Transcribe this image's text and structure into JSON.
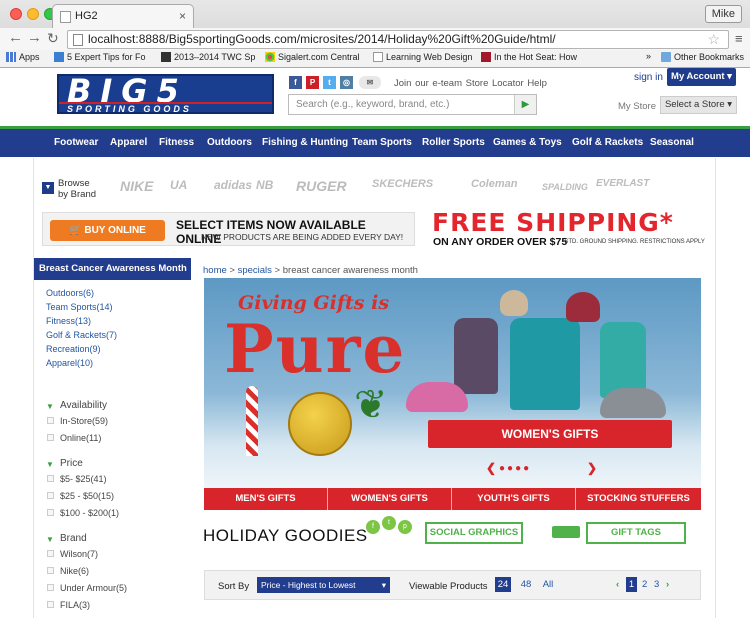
{
  "browser": {
    "tab_title": "HG2",
    "tab_close": "×",
    "user": "Mike",
    "url": "localhost:8888/Big5sportingGoods.com/microsites/2014/Holiday%20Gift%20Guide/html/",
    "bookmarks": [
      "Apps",
      "5 Expert Tips for Fo",
      "2013–2014 TWC Sp",
      "Sigalert.com Central",
      "Learning Web Design",
      "In the Hot Seat: How"
    ],
    "other_bookmarks": "Other Bookmarks",
    "overflow": "»"
  },
  "header": {
    "logo_big": "BIG5",
    "logo_small": "SPORTING GOODS",
    "social": [
      "f",
      "P",
      "t",
      "◎",
      "✉"
    ],
    "links": "Join our e-team   Store Locator   Help",
    "search_placeholder": "Search (e.g., keyword, brand, etc.)",
    "search_btn": "▶",
    "signin": "sign in",
    "account": "My Account ▾",
    "mystore": "My Store",
    "select_store": "Select a Store ▾"
  },
  "nav": [
    "Footwear",
    "Apparel",
    "Fitness",
    "Outdoors",
    "Fishing & Hunting",
    "Team Sports",
    "Roller Sports",
    "Games & Toys",
    "Golf & Rackets",
    "Seasonal"
  ],
  "brands": {
    "browse_line1": "Browse",
    "browse_line2": "by Brand",
    "browse_icon": "▼",
    "list": [
      "NIKE",
      "UA",
      "adidas",
      "NB",
      "RUGER",
      "SKECHERS",
      "Coleman",
      "SPALDING",
      "EVERLAST"
    ]
  },
  "promo": {
    "buy_online": "BUY ONLINE",
    "line1": "SELECT ITEMS NOW AVAILABLE ONLINE",
    "line2": "NEW PRODUCTS ARE BEING ADDED EVERY DAY!",
    "free_shipping": "FREE SHIPPING*",
    "fs_sub": "ON ANY ORDER OVER $75",
    "fs_note": "*STD. GROUND SHIPPING. RESTRICTIONS APPLY"
  },
  "sidebar": {
    "heading": "Breast Cancer Awareness Month",
    "categories": [
      "Outdoors(6)",
      "Team Sports(14)",
      "Fitness(13)",
      "Golf & Rackets(7)",
      "Recreation(9)",
      "Apparel(10)"
    ],
    "facets": [
      {
        "title": "Availability",
        "options": [
          "In-Store(59)",
          "Online(11)"
        ]
      },
      {
        "title": "Price",
        "options": [
          "$5- $25(41)",
          "$25 - $50(15)",
          "$100 - $200(1)"
        ]
      },
      {
        "title": "Brand",
        "options": [
          "Wilson(7)",
          "Nike(6)",
          "Under Armour(5)",
          "FILA(3)"
        ]
      }
    ]
  },
  "breadcrumb": {
    "home": "home",
    "sep": " > ",
    "specials": "specials",
    "current": "breast cancer awareness month"
  },
  "banner": {
    "line1": "Giving Gifts is",
    "line2": "Pure",
    "joy": "J  Y",
    "cta": "WOMEN'S GIFTS",
    "prev": "❮",
    "next": "❯",
    "dots": "●●●●"
  },
  "gift_tabs": [
    "MEN'S GIFTS",
    "WOMEN'S GIFTS",
    "YOUTH'S GIFTS",
    "STOCKING STUFFERS"
  ],
  "goodies": {
    "title": "HOLIDAY GOODIES",
    "social_graphics": "SOCIAL GRAPHICS",
    "gift_tags": "GIFT TAGS"
  },
  "sort": {
    "label": "Sort By",
    "selected": "Price - Highest to Lowest",
    "viewable_label": "Viewable Products",
    "per_page": [
      "24",
      "48",
      "All"
    ],
    "pages": [
      "1",
      "2",
      "3"
    ],
    "prev": "‹",
    "next": "›"
  },
  "colors": {
    "navy": "#233d8e",
    "green": "#3a9f3f",
    "red": "#d8252b",
    "orange": "#ee7b22"
  }
}
